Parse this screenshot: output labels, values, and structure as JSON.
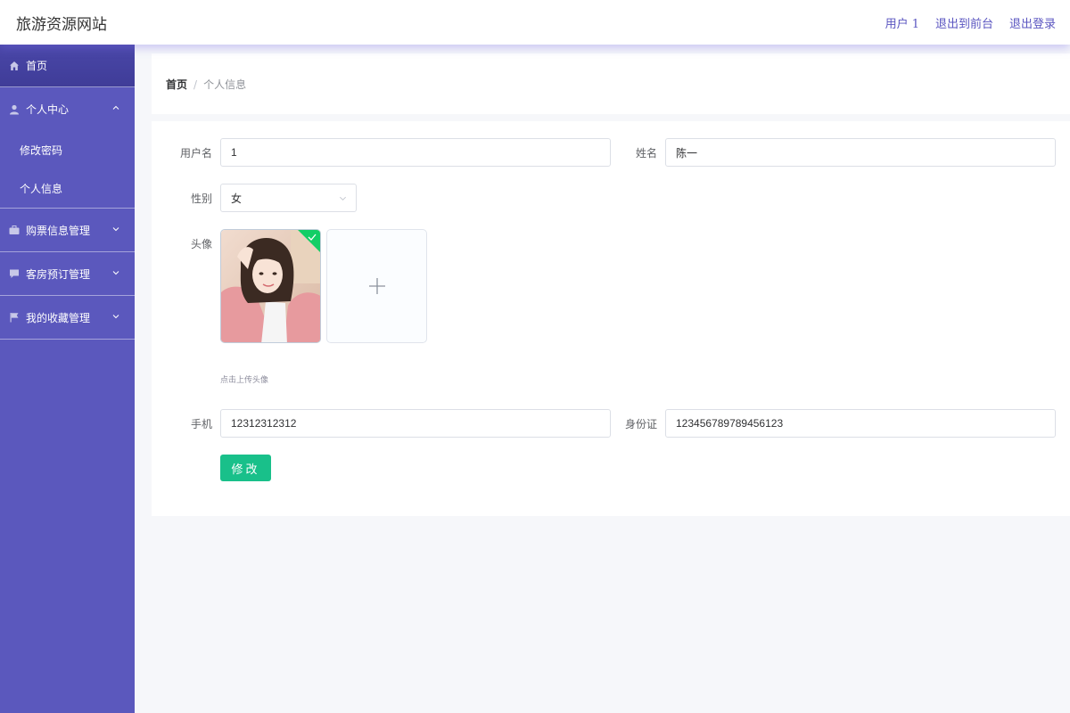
{
  "header": {
    "title": "旅游资源网站",
    "links": [
      "用户 1",
      "退出到前台",
      "退出登录"
    ]
  },
  "sidebar": {
    "home": "首页",
    "personal_center": "个人中心",
    "sub_items": [
      "修改密码",
      "个人信息"
    ],
    "ticket_management": "购票信息管理",
    "room_booking": "客房预订管理",
    "favorites": "我的收藏管理",
    "icons": [
      "home-icon",
      "user-icon",
      "briefcase-icon",
      "chat-icon",
      "flag-icon"
    ]
  },
  "breadcrumb": {
    "home": "首页",
    "separator": "/",
    "current": "个人信息"
  },
  "form": {
    "username_label": "用户名",
    "username_value": "1",
    "name_label": "姓名",
    "name_value": "陈一",
    "gender_label": "性别",
    "gender_value": "女",
    "avatar_label": "头像",
    "upload_hint": "点击上传头像",
    "phone_label": "手机",
    "phone_value": "12312312312",
    "id_label": "身份证",
    "id_value": "123456789789456123",
    "submit_label": "修改"
  },
  "colors": {
    "sidebar_bg": "#5b58bd",
    "accent": "#5a55c0",
    "submit": "#19c08a",
    "success": "#13ce66"
  }
}
